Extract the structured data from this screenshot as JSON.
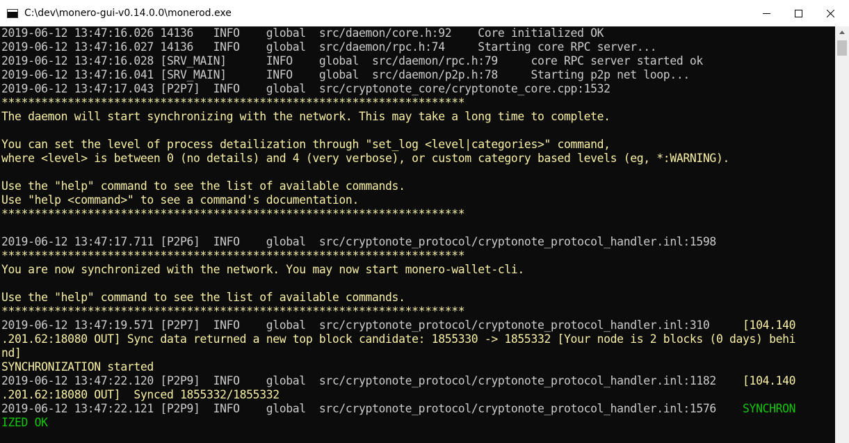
{
  "window": {
    "title": "C:\\dev\\monero-gui-v0.14.0.0\\monerod.exe",
    "icon": "console-app-icon",
    "minimize_icon": "minimize-icon",
    "maximize_icon": "maximize-icon",
    "close_icon": "close-icon"
  },
  "colors": {
    "background": "#0c0c0c",
    "default_text": "#cccccc",
    "highlight_yellow": "#f9f1a5",
    "success_green": "#16c60c"
  },
  "console": {
    "lines": [
      {
        "color": "gray",
        "segments": [
          {
            "text": "2019-06-12 13:47:16.026 14136   INFO    global  src/daemon/core.h:92    Core initialized OK",
            "color": "gray"
          }
        ]
      },
      {
        "color": "gray",
        "segments": [
          {
            "text": "2019-06-12 13:47:16.027 14136   INFO    global  src/daemon/rpc.h:74     Starting core RPC server...",
            "color": "gray"
          }
        ]
      },
      {
        "color": "gray",
        "segments": [
          {
            "text": "2019-06-12 13:47:16.028 [SRV_MAIN]      INFO    global  src/daemon/rpc.h:79     core RPC server started ok",
            "color": "gray"
          }
        ]
      },
      {
        "color": "gray",
        "segments": [
          {
            "text": "2019-06-12 13:47:16.041 [SRV_MAIN]      INFO    global  src/daemon/p2p.h:78     Starting p2p net loop...",
            "color": "gray"
          }
        ]
      },
      {
        "color": "gray",
        "segments": [
          {
            "text": "2019-06-12 13:47:17.043 [P2P7]  INFO    global  src/cryptonote_core/cryptonote_core.cpp:1532",
            "color": "gray"
          }
        ]
      },
      {
        "color": "yellow",
        "segments": [
          {
            "text": "**********************************************************************",
            "color": "yellow"
          }
        ]
      },
      {
        "color": "yellow",
        "segments": [
          {
            "text": "The daemon will start synchronizing with the network. This may take a long time to complete.",
            "color": "yellow"
          }
        ]
      },
      {
        "color": "yellow",
        "segments": [
          {
            "text": "",
            "color": "yellow"
          }
        ]
      },
      {
        "color": "yellow",
        "segments": [
          {
            "text": "You can set the level of process detailization through \"set_log <level|categories>\" command,",
            "color": "yellow"
          }
        ]
      },
      {
        "color": "yellow",
        "segments": [
          {
            "text": "where <level> is between 0 (no details) and 4 (very verbose), or custom category based levels (eg, *:WARNING).",
            "color": "yellow"
          }
        ]
      },
      {
        "color": "yellow",
        "segments": [
          {
            "text": "",
            "color": "yellow"
          }
        ]
      },
      {
        "color": "yellow",
        "segments": [
          {
            "text": "Use the \"help\" command to see the list of available commands.",
            "color": "yellow"
          }
        ]
      },
      {
        "color": "yellow",
        "segments": [
          {
            "text": "Use \"help <command>\" to see a command's documentation.",
            "color": "yellow"
          }
        ]
      },
      {
        "color": "yellow",
        "segments": [
          {
            "text": "**********************************************************************",
            "color": "yellow"
          }
        ]
      },
      {
        "color": "gray",
        "segments": [
          {
            "text": "",
            "color": "gray"
          }
        ]
      },
      {
        "color": "gray",
        "segments": [
          {
            "text": "2019-06-12 13:47:17.711 [P2P6]  INFO    global  src/cryptonote_protocol/cryptonote_protocol_handler.inl:1598",
            "color": "gray"
          }
        ]
      },
      {
        "color": "yellow",
        "segments": [
          {
            "text": "**********************************************************************",
            "color": "yellow"
          }
        ]
      },
      {
        "color": "yellow",
        "segments": [
          {
            "text": "You are now synchronized with the network. You may now start monero-wallet-cli.",
            "color": "yellow"
          }
        ]
      },
      {
        "color": "yellow",
        "segments": [
          {
            "text": "",
            "color": "yellow"
          }
        ]
      },
      {
        "color": "yellow",
        "segments": [
          {
            "text": "Use the \"help\" command to see the list of available commands.",
            "color": "yellow"
          }
        ]
      },
      {
        "color": "yellow",
        "segments": [
          {
            "text": "**********************************************************************",
            "color": "yellow"
          }
        ]
      },
      {
        "color": "gray",
        "segments": [
          {
            "text": "2019-06-12 13:47:19.571 [P2P7]  INFO    global  src/cryptonote_protocol/cryptonote_protocol_handler.inl:310     ",
            "color": "gray"
          },
          {
            "text": "[104.140",
            "color": "yellow"
          }
        ]
      },
      {
        "color": "yellow",
        "segments": [
          {
            "text": ".201.62:18080 OUT] Sync data returned a new top block candidate: 1855330 -> 1855332 [Your node is 2 blocks (0 days) behi",
            "color": "yellow"
          }
        ]
      },
      {
        "color": "yellow",
        "segments": [
          {
            "text": "nd]",
            "color": "yellow"
          }
        ]
      },
      {
        "color": "yellow",
        "segments": [
          {
            "text": "SYNCHRONIZATION started",
            "color": "yellow"
          }
        ]
      },
      {
        "color": "gray",
        "segments": [
          {
            "text": "2019-06-12 13:47:22.120 [P2P9]  INFO    global  src/cryptonote_protocol/cryptonote_protocol_handler.inl:1182    ",
            "color": "gray"
          },
          {
            "text": "[104.140",
            "color": "yellow"
          }
        ]
      },
      {
        "color": "yellow",
        "segments": [
          {
            "text": ".201.62:18080 OUT]  Synced 1855332/1855332",
            "color": "yellow"
          }
        ]
      },
      {
        "color": "gray",
        "segments": [
          {
            "text": "2019-06-12 13:47:22.121 [P2P9]  INFO    global  src/cryptonote_protocol/cryptonote_protocol_handler.inl:1576    ",
            "color": "gray"
          },
          {
            "text": "SYNCHRON",
            "color": "green"
          }
        ]
      },
      {
        "color": "green",
        "segments": [
          {
            "text": "IZED OK",
            "color": "green"
          }
        ]
      }
    ]
  }
}
